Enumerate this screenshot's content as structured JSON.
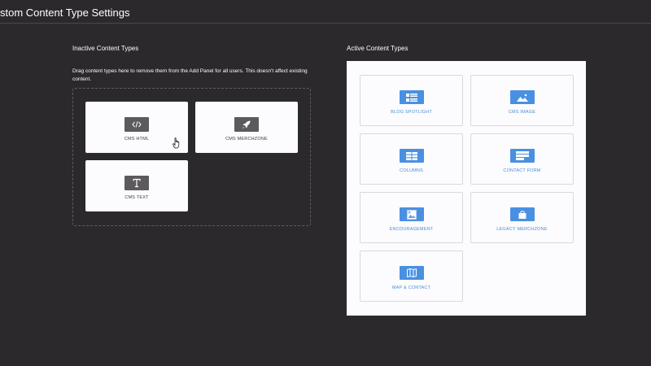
{
  "header": {
    "title": "stom Content Type Settings"
  },
  "inactive": {
    "title": "Inactive Content Types",
    "help": "Drag content types here to remove them from the Add Panel for all users. This doesn't affect existing content.",
    "items": [
      {
        "label": "CMS HTML",
        "icon": "code-icon"
      },
      {
        "label": "CMS MERCHZONE",
        "icon": "rocket-icon"
      },
      {
        "label": "CMS TEXT",
        "icon": "text-icon"
      }
    ]
  },
  "active": {
    "title": "Active Content Types",
    "items": [
      {
        "label": "BLOG SPOTLIGHT",
        "icon": "list-icon"
      },
      {
        "label": "CMS IMAGE",
        "icon": "image-icon"
      },
      {
        "label": "COLUMNS",
        "icon": "columns-icon"
      },
      {
        "label": "CONTACT FORM",
        "icon": "form-icon"
      },
      {
        "label": "ENCOURAGEMENT",
        "icon": "broken-image-icon"
      },
      {
        "label": "LEGACY MERCHZONE",
        "icon": "bag-icon"
      },
      {
        "label": "MAP & CONTACT",
        "icon": "map-icon"
      }
    ]
  },
  "colors": {
    "background": "#2b292b",
    "card": "#fcfbfd",
    "inactive_icon": "#5c5a5c",
    "active_icon": "#4a90e2",
    "active_label": "#4a8fd6"
  }
}
